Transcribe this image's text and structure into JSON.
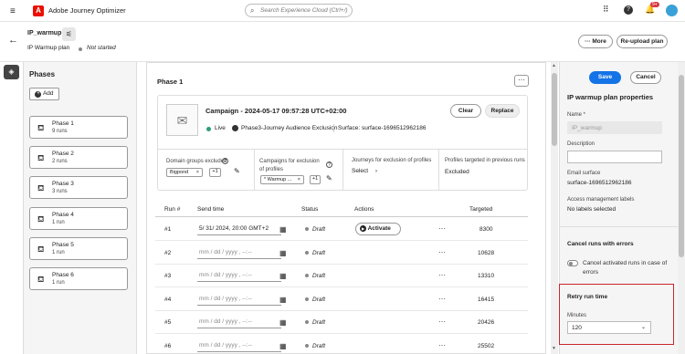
{
  "app": {
    "title": "Adobe Journey Optimizer",
    "logo_letter": "A",
    "notif_count": "9+"
  },
  "search": {
    "placeholder": "Search Experience Cloud (Ctrl+/)"
  },
  "plan": {
    "name": "IP_warmup",
    "type": "IP Warmup plan",
    "status": "Not started",
    "more_label": "More",
    "reupload_label": "Re-upload plan"
  },
  "phases": {
    "title": "Phases",
    "add_label": "Add",
    "items": [
      {
        "name": "Phase 1",
        "runs": "9 runs"
      },
      {
        "name": "Phase 2",
        "runs": "2 runs"
      },
      {
        "name": "Phase 3",
        "runs": "3 runs"
      },
      {
        "name": "Phase 4",
        "runs": "1 run"
      },
      {
        "name": "Phase 5",
        "runs": "1 run"
      },
      {
        "name": "Phase 6",
        "runs": "1 run"
      }
    ]
  },
  "phase": {
    "title": "Phase 1"
  },
  "campaign": {
    "title": "Campaign - 2024-05-17 09:57:28 UTC+02:00",
    "status": "Live",
    "audience": "Phase3-Journey Audience Exclusion",
    "surface": "Surface: surface-1696512962186",
    "clear_label": "Clear",
    "replace_label": "Replace"
  },
  "exclusions": {
    "domain_label": "Domain groups excluded",
    "domain_tag": "Bigpond",
    "domain_more": "+1",
    "campaigns_label": "Campaigns for exclusion of profiles",
    "campaigns_tag": "* Warmup ...",
    "campaigns_more": "+1",
    "journeys_label": "Journeys for exclusion of profiles",
    "journeys_value": "Select",
    "targeted_label": "Profiles targeted in previous runs",
    "targeted_value": "Excluded"
  },
  "table": {
    "headers": {
      "run": "Run #",
      "send": "Send time",
      "status": "Status",
      "actions": "Actions",
      "targeted": "Targeted"
    },
    "activate_label": "Activate",
    "rows": [
      {
        "run": "#1",
        "send": "5/ 31/ 2024, 20:00  GMT+2",
        "status": "Draft",
        "targeted": "8300",
        "filled": true
      },
      {
        "run": "#2",
        "send": "mm / dd / yyyy , --:--",
        "status": "Draft",
        "targeted": "10628",
        "filled": false
      },
      {
        "run": "#3",
        "send": "mm / dd / yyyy , --:--",
        "status": "Draft",
        "targeted": "13310",
        "filled": false
      },
      {
        "run": "#4",
        "send": "mm / dd / yyyy , --:--",
        "status": "Draft",
        "targeted": "16415",
        "filled": false
      },
      {
        "run": "#5",
        "send": "mm / dd / yyyy , --:--",
        "status": "Draft",
        "targeted": "20426",
        "filled": false
      },
      {
        "run": "#6",
        "send": "mm / dd / yyyy , --:--",
        "status": "Draft",
        "targeted": "25502",
        "filled": false
      }
    ]
  },
  "props": {
    "save_label": "Save",
    "cancel_label": "Cancel",
    "title": "IP warmup plan properties",
    "name_label": "Name *",
    "name_value": "IP_warmup",
    "desc_label": "Description",
    "surface_label": "Email surface",
    "surface_value": "surface-1696512962186",
    "access_label": "Access management labels",
    "access_value": "No labels selected",
    "cancel_runs_title": "Cancel runs with errors",
    "cancel_toggle_label": "Cancel activated runs in case of errors",
    "retry_title": "Retry run time",
    "minutes_label": "Minutes",
    "minutes_value": "120"
  },
  "colors": {
    "accent": "#1473e6",
    "brand": "#eb1000",
    "live": "#2d9d78",
    "highlight": "#c9252d"
  }
}
